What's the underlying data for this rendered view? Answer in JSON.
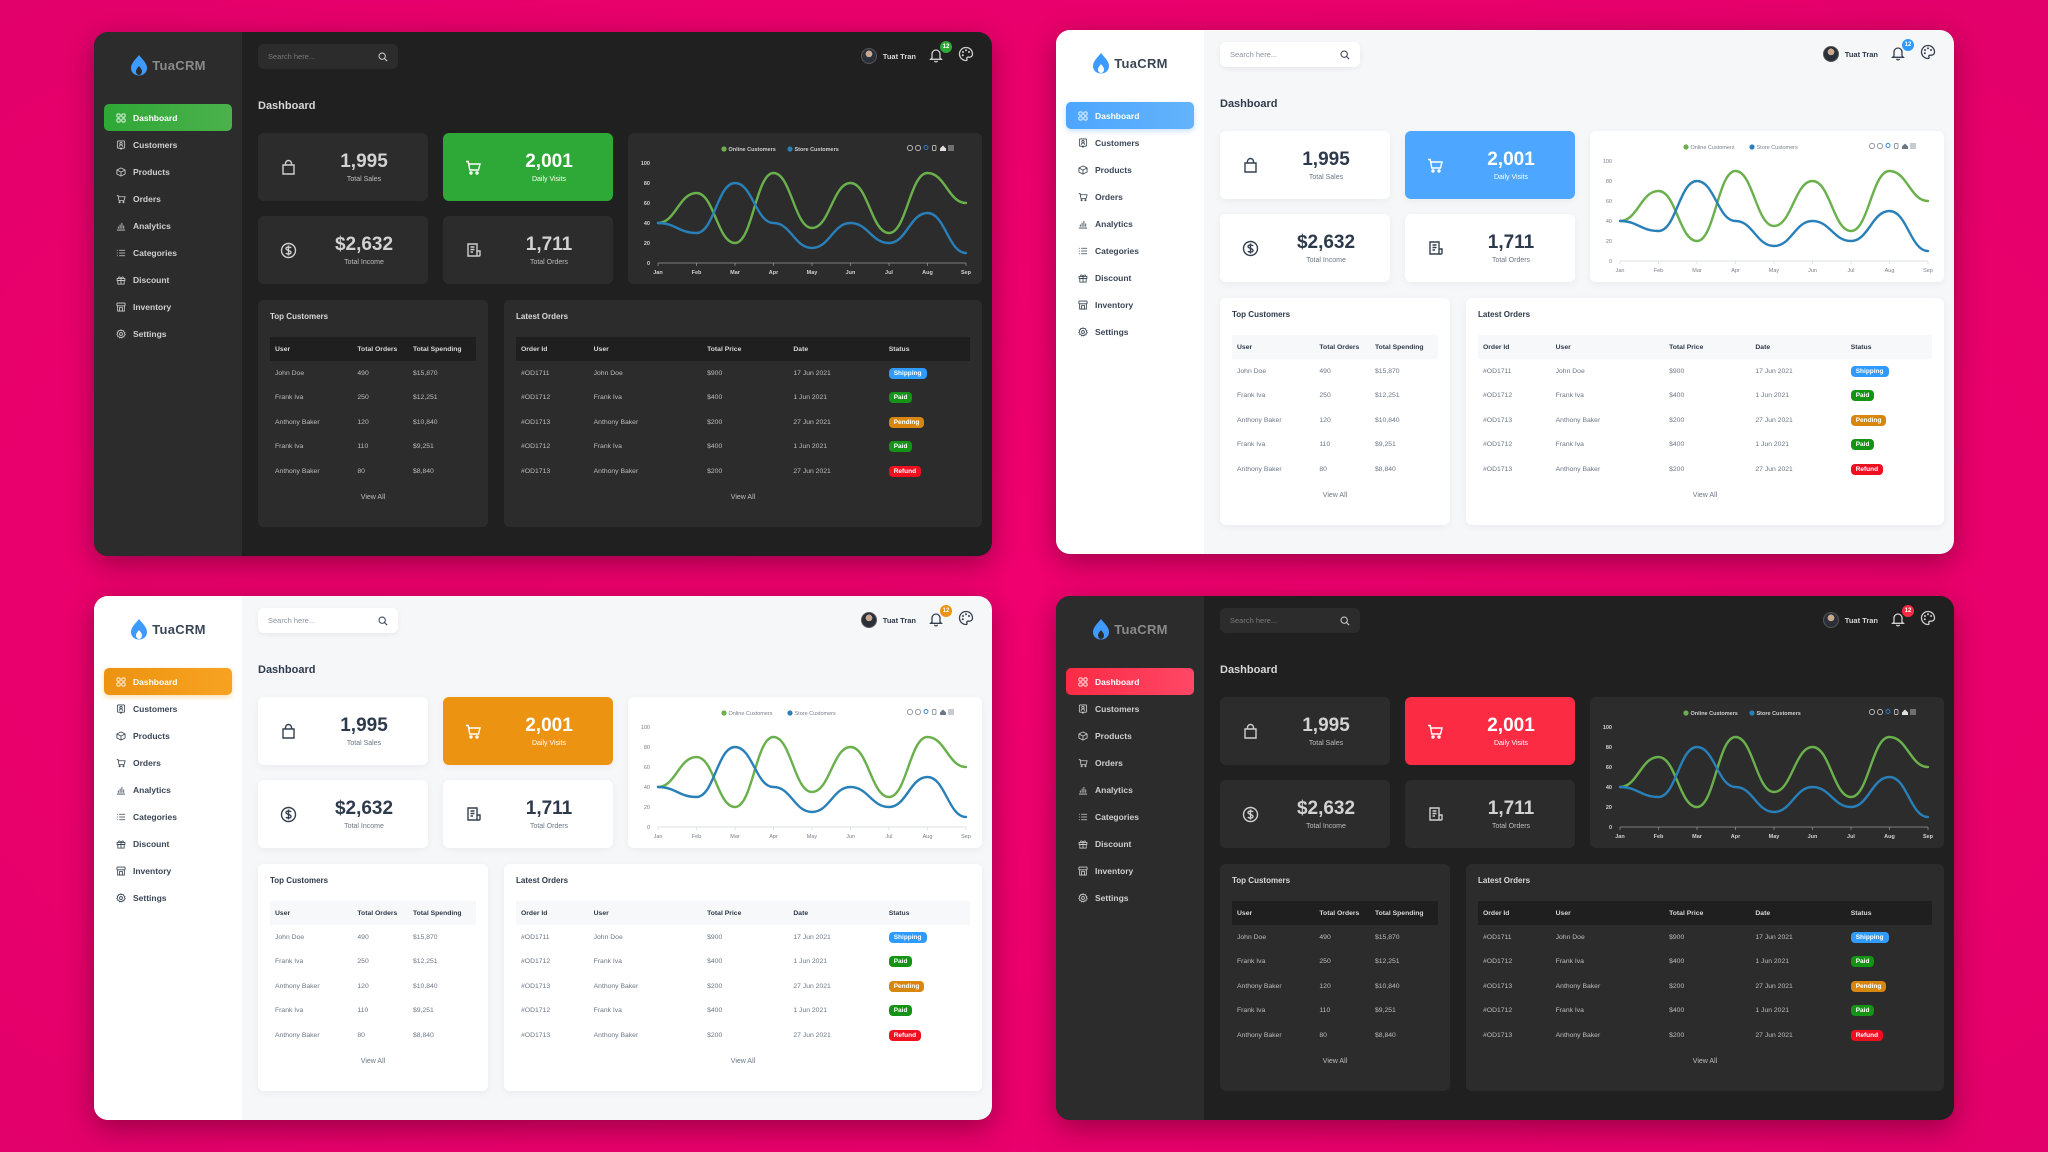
{
  "app": {
    "brand": "TuaCRM",
    "page_title": "Dashboard",
    "search_placeholder": "Search here...",
    "user_name": "Tuat Tran",
    "notification_count": "12",
    "logo_color": "#3d9bff"
  },
  "sidebar": {
    "items": [
      {
        "label": "Dashboard",
        "icon": "dashboard-grid-icon"
      },
      {
        "label": "Customers",
        "icon": "customers-icon"
      },
      {
        "label": "Products",
        "icon": "products-box-icon"
      },
      {
        "label": "Orders",
        "icon": "cart-icon"
      },
      {
        "label": "Analytics",
        "icon": "bar-chart-icon"
      },
      {
        "label": "Categories",
        "icon": "list-icon"
      },
      {
        "label": "Discount",
        "icon": "gift-icon"
      },
      {
        "label": "Inventory",
        "icon": "store-icon"
      },
      {
        "label": "Settings",
        "icon": "gear-icon"
      }
    ],
    "active_index": 0
  },
  "stats": [
    {
      "value": "1,995",
      "label": "Total Sales",
      "icon": "shopping-bag-icon"
    },
    {
      "value": "2,001",
      "label": "Daily Visits",
      "icon": "cart-icon",
      "accent": true
    },
    {
      "value": "$2,632",
      "label": "Total Income",
      "icon": "dollar-circle-icon"
    },
    {
      "value": "1,711",
      "label": "Total Orders",
      "icon": "receipt-icon"
    }
  ],
  "chart_data": {
    "type": "line",
    "title": "",
    "categories": [
      "Jan",
      "Feb",
      "Mar",
      "Apr",
      "May",
      "Jun",
      "Jul",
      "Aug",
      "Sep"
    ],
    "series": [
      {
        "name": "Online Customers",
        "color": "#6ab04c",
        "values": [
          40,
          70,
          20,
          90,
          35,
          80,
          30,
          90,
          60
        ]
      },
      {
        "name": "Store Customers",
        "color": "#2980b9",
        "values": [
          40,
          30,
          80,
          40,
          15,
          40,
          20,
          50,
          10
        ]
      }
    ],
    "yticks": [
      0,
      20,
      40,
      60,
      80,
      100
    ],
    "ylim": [
      0,
      100
    ],
    "xlabel": "",
    "ylabel": "",
    "grid": false,
    "legend": "top",
    "toolbar_icons": [
      "zoom-in-icon",
      "zoom-out-icon",
      "magnifier-icon",
      "pan-hand-icon",
      "home-icon",
      "menu-icon"
    ],
    "curve": "smooth"
  },
  "top_customers": {
    "title": "Top Customers",
    "columns": [
      "User",
      "Total Orders",
      "Total Spending"
    ],
    "rows": [
      [
        "John Doe",
        "490",
        "$15,870"
      ],
      [
        "Frank Iva",
        "250",
        "$12,251"
      ],
      [
        "Anthony Baker",
        "120",
        "$10,840"
      ],
      [
        "Frank Iva",
        "110",
        "$9,251"
      ],
      [
        "Anthony Baker",
        "80",
        "$8,840"
      ]
    ],
    "view_all": "View All"
  },
  "latest_orders": {
    "title": "Latest Orders",
    "columns": [
      "Order Id",
      "User",
      "Total Price",
      "Date",
      "Status"
    ],
    "rows": [
      {
        "id": "#OD1711",
        "user": "John Doe",
        "price": "$900",
        "date": "17 Jun 2021",
        "status": "Shipping"
      },
      {
        "id": "#OD1712",
        "user": "Frank Iva",
        "price": "$400",
        "date": "1 Jun 2021",
        "status": "Paid"
      },
      {
        "id": "#OD1713",
        "user": "Anthony Baker",
        "price": "$200",
        "date": "27 Jun 2021",
        "status": "Pending"
      },
      {
        "id": "#OD1712",
        "user": "Frank Iva",
        "price": "$400",
        "date": "1 Jun 2021",
        "status": "Paid"
      },
      {
        "id": "#OD1713",
        "user": "Anthony Baker",
        "price": "$200",
        "date": "27 Jun 2021",
        "status": "Refund"
      }
    ],
    "status_colors": {
      "Shipping": "#2f9bff",
      "Paid": "#149414",
      "Pending": "#d9860f",
      "Refund": "#f00f1e"
    },
    "view_all": "View All"
  },
  "themes": [
    {
      "name": "dark-green",
      "mode": "dark",
      "accent": "#2ea836",
      "accent_gradient_end": "#4cb14c"
    },
    {
      "name": "light-blue",
      "mode": "light",
      "accent": "#4da6ff",
      "accent_gradient_end": "#64b3fb"
    },
    {
      "name": "light-orange",
      "mode": "light",
      "accent": "#ec9311",
      "accent_gradient_end": "#f7a321"
    },
    {
      "name": "dark-red",
      "mode": "dark",
      "accent": "#fb2b44",
      "accent_gradient_end": "#ff4766"
    }
  ],
  "background_color": "#ee006d"
}
